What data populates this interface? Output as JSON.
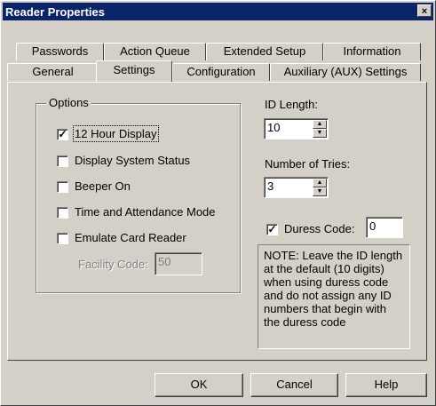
{
  "window": {
    "title": "Reader Properties",
    "close_glyph": "×"
  },
  "tabs_row1": [
    {
      "label": "Passwords"
    },
    {
      "label": "Action Queue"
    },
    {
      "label": "Extended Setup"
    },
    {
      "label": "Information"
    }
  ],
  "tabs_row2": [
    {
      "label": "General"
    },
    {
      "label": "Settings",
      "active": true
    },
    {
      "label": "Configuration"
    },
    {
      "label": "Auxiliary (AUX) Settings"
    }
  ],
  "options": {
    "group_label": "Options",
    "items": [
      {
        "label": "12 Hour Display",
        "checked": true
      },
      {
        "label": "Display System Status",
        "checked": false
      },
      {
        "label": "Beeper On",
        "checked": false
      },
      {
        "label": "Time and Attendance Mode",
        "checked": false
      },
      {
        "label": "Emulate Card Reader",
        "checked": false
      }
    ],
    "facility_code": {
      "label": "Facility Code:",
      "value": "50",
      "enabled": false
    }
  },
  "id_length": {
    "label": "ID Length:",
    "value": "10"
  },
  "number_of_tries": {
    "label": "Number of Tries:",
    "value": "3"
  },
  "duress_code": {
    "label": "Duress Code:",
    "checked": true,
    "value": "0"
  },
  "note_text": "NOTE: Leave the ID length at the default (10 digits) when using duress code and do not assign any ID numbers that begin with the duress code",
  "buttons": {
    "ok": "OK",
    "cancel": "Cancel",
    "help": "Help"
  }
}
